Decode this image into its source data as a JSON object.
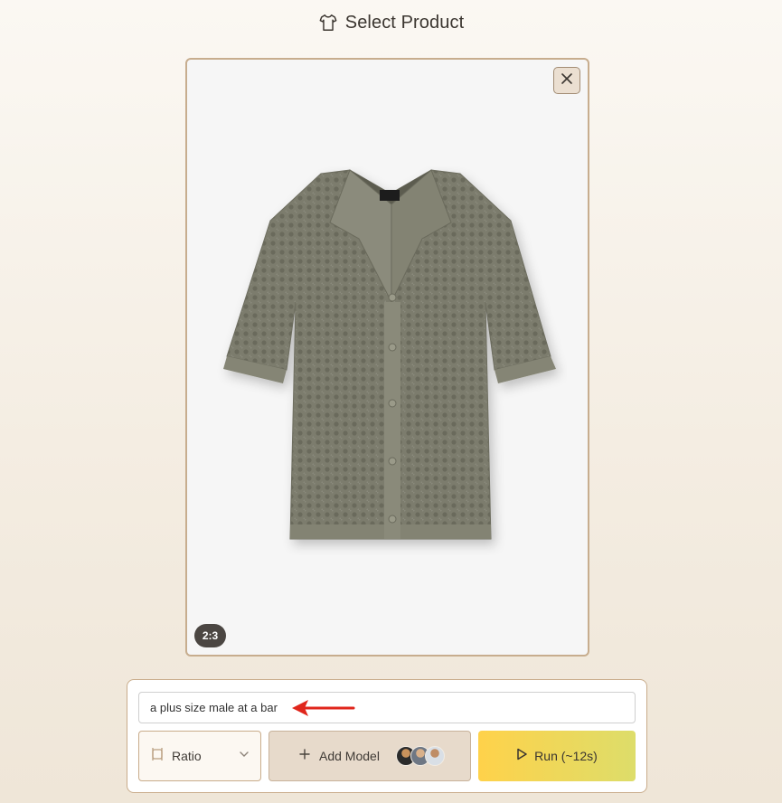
{
  "header": {
    "title": "Select Product",
    "icon": "tshirt-icon"
  },
  "product_card": {
    "image": "olive-green-knit-short-sleeve-shirt",
    "ratio_badge": "2:3",
    "close_icon": "close-icon"
  },
  "prompt": {
    "value": "a plus size male at a bar"
  },
  "controls": {
    "ratio": {
      "label": "Ratio",
      "icon": "aspect-ratio-icon"
    },
    "add_model": {
      "label": "Add Model",
      "icon": "plus-icon"
    },
    "run": {
      "label": "Run (~12s)",
      "icon": "play-icon"
    }
  },
  "colors": {
    "accent_border": "#c7ad8e",
    "run_gradient_start": "#ffd24a",
    "run_gradient_end": "#dddd6a",
    "annotation_arrow": "#e0261c"
  }
}
